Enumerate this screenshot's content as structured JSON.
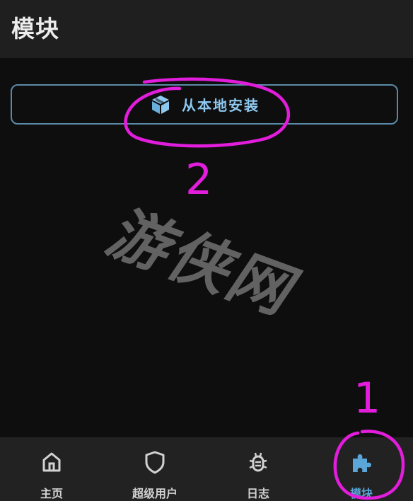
{
  "header": {
    "title": "模块"
  },
  "main": {
    "install_button": {
      "label": "从本地安装",
      "icon": "package-box-icon"
    }
  },
  "watermark": {
    "text": "游侠网"
  },
  "annotations": {
    "step_1": "1",
    "step_2": "2",
    "color": "#e21ddc"
  },
  "bottom_nav": {
    "items": [
      {
        "label": "主页",
        "icon": "home-icon",
        "active": false
      },
      {
        "label": "超级用户",
        "icon": "shield-icon",
        "active": false
      },
      {
        "label": "日志",
        "icon": "bug-icon",
        "active": false
      },
      {
        "label": "模块",
        "icon": "puzzle-icon",
        "active": true
      }
    ]
  },
  "colors": {
    "background": "#0e0e0f",
    "bar": "#1f1f1f",
    "accent": "#5aa6d9",
    "button_border": "#5b8aa8",
    "annotation": "#e21ddc"
  }
}
